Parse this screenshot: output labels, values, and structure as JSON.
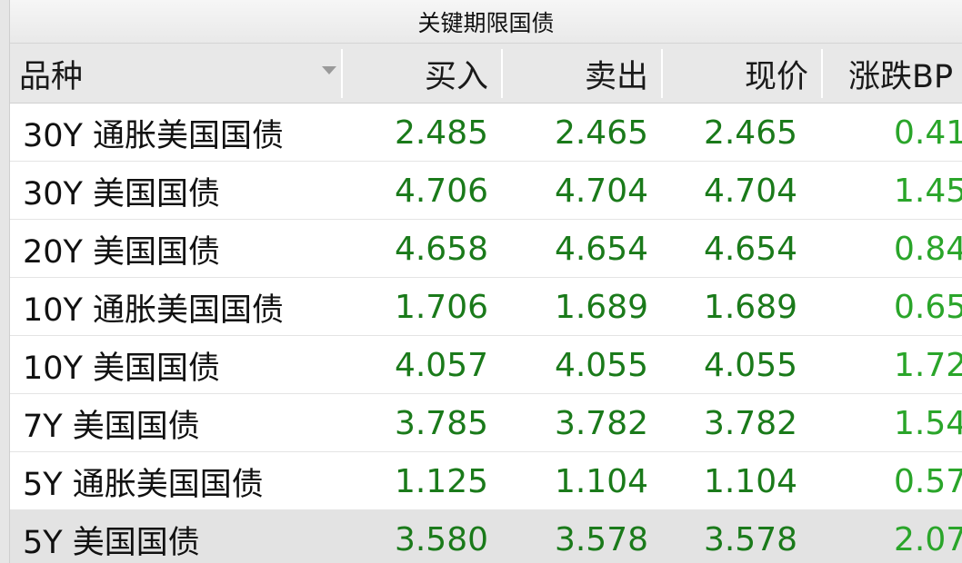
{
  "panel": {
    "title": "关键期限国债"
  },
  "columns": {
    "name": "品种",
    "bid": "买入",
    "ask": "卖出",
    "last": "现价",
    "change": "涨跌BP"
  },
  "rows": [
    {
      "name": "30Y 通胀美国国债",
      "bid": "2.485",
      "ask": "2.465",
      "last": "2.465",
      "change": "0.41"
    },
    {
      "name": "30Y 美国国债",
      "bid": "4.706",
      "ask": "4.704",
      "last": "4.704",
      "change": "1.45"
    },
    {
      "name": "20Y 美国国债",
      "bid": "4.658",
      "ask": "4.654",
      "last": "4.654",
      "change": "0.84"
    },
    {
      "name": "10Y 通胀美国国债",
      "bid": "1.706",
      "ask": "1.689",
      "last": "1.689",
      "change": "0.65"
    },
    {
      "name": "10Y 美国国债",
      "bid": "4.057",
      "ask": "4.055",
      "last": "4.055",
      "change": "1.72"
    },
    {
      "name": "7Y 美国国债",
      "bid": "3.785",
      "ask": "3.782",
      "last": "3.782",
      "change": "1.54"
    },
    {
      "name": "5Y 通胀美国国债",
      "bid": "1.125",
      "ask": "1.104",
      "last": "1.104",
      "change": "0.57"
    },
    {
      "name": "5Y 美国国债",
      "bid": "3.580",
      "ask": "3.578",
      "last": "3.578",
      "change": "2.07"
    }
  ],
  "colors": {
    "value_green": "#1a7a1a",
    "change_green": "#2aa52a",
    "header_bg": "#e8e8e8",
    "selected_row_bg": "#e3e3e3"
  },
  "icons": {
    "sort": "sort-down-icon"
  }
}
